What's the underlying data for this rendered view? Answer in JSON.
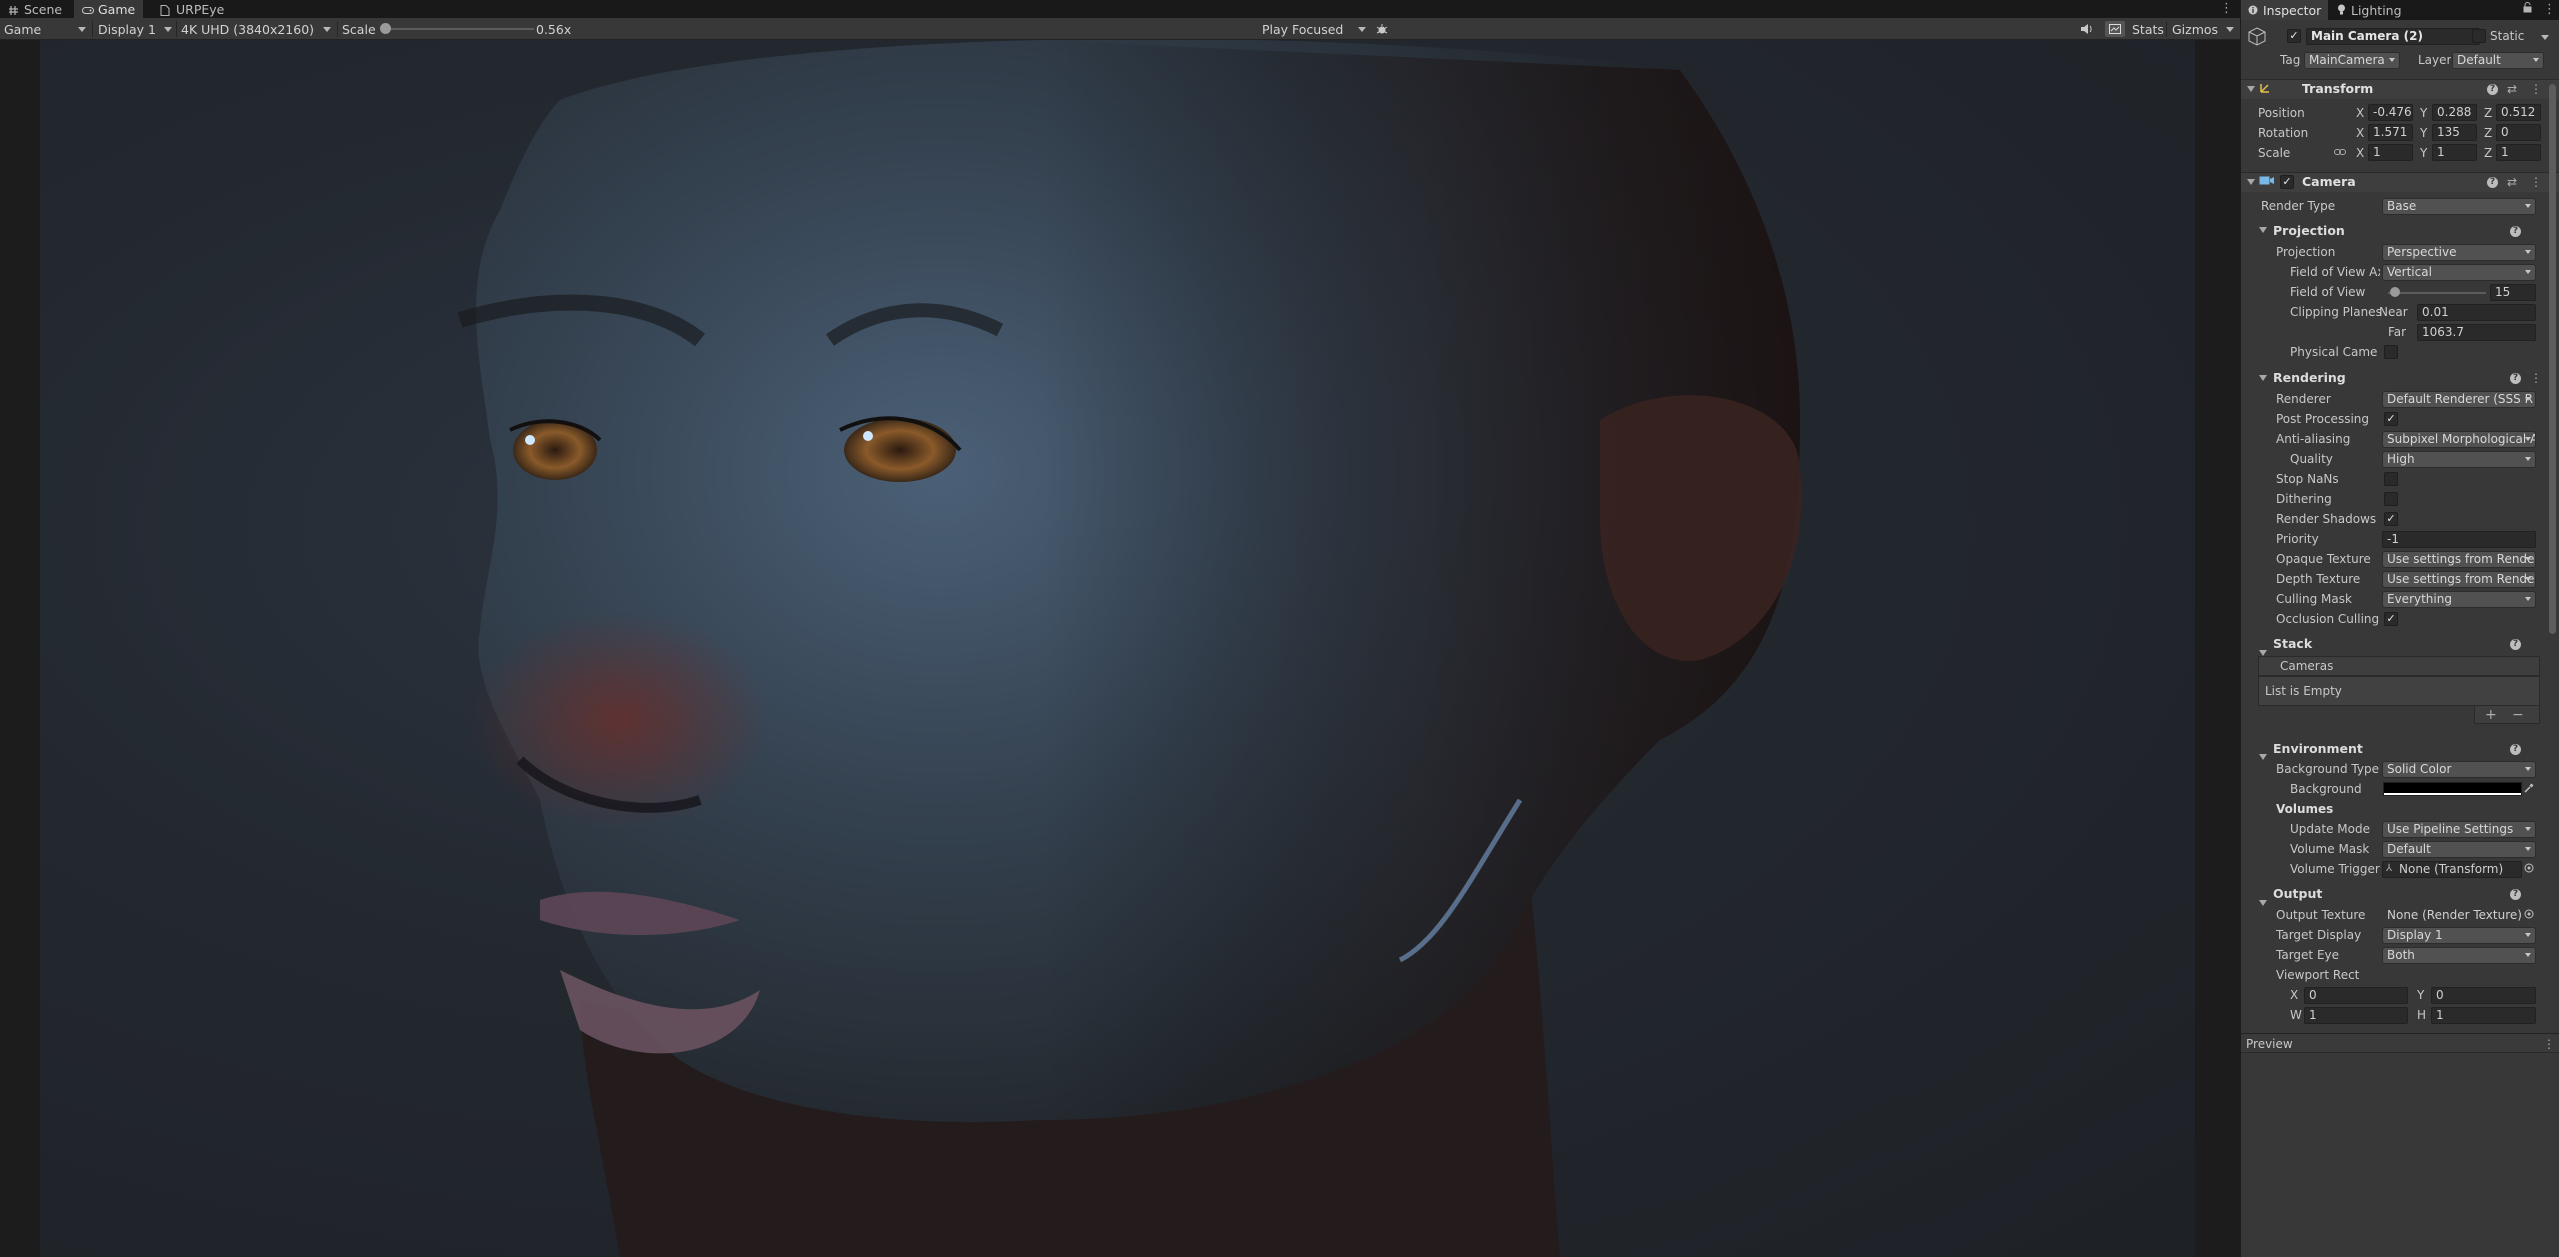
{
  "tabs": [
    {
      "label": "Scene",
      "icon": "hash-icon",
      "active": false
    },
    {
      "label": "Game",
      "icon": "gamepad-icon",
      "active": true
    },
    {
      "label": "URPEye",
      "icon": "document-icon",
      "active": false
    }
  ],
  "game_toolbar": {
    "view_mode": "Game",
    "display": "Display 1",
    "resolution": "4K UHD (3840x2160)",
    "scale_label": "Scale",
    "scale_value": "0.56x",
    "play_mode": "Play Focused",
    "stats": "Stats",
    "gizmos": "Gizmos"
  },
  "inspector": {
    "tabs": [
      {
        "label": "Inspector",
        "icon": "info-icon"
      },
      {
        "label": "Lighting",
        "icon": "bulb-icon"
      }
    ],
    "object": {
      "name": "Main Camera (2)",
      "static_label": "Static",
      "tag_label": "Tag",
      "tag": "MainCamera",
      "layer_label": "Layer",
      "layer": "Default"
    },
    "transform": {
      "title": "Transform",
      "position_label": "Position",
      "rotation_label": "Rotation",
      "scale_label": "Scale",
      "position": {
        "x": "-0.476",
        "y": "0.288",
        "z": "0.512"
      },
      "rotation": {
        "x": "1.571",
        "y": "135",
        "z": "0"
      },
      "scale": {
        "x": "1",
        "y": "1",
        "z": "1"
      }
    },
    "camera": {
      "title": "Camera",
      "render_type_label": "Render Type",
      "render_type": "Base",
      "projection": {
        "title": "Projection",
        "projection_label": "Projection",
        "projection": "Perspective",
        "fov_axis_label": "Field of View Ax",
        "fov_axis": "Vertical",
        "fov_label": "Field of View",
        "fov": "15",
        "clip_label": "Clipping Planes",
        "near_label": "Near",
        "near": "0.01",
        "far_label": "Far",
        "far": "1063.7",
        "physical_label": "Physical Camer"
      },
      "rendering": {
        "title": "Rendering",
        "renderer_label": "Renderer",
        "renderer": "Default Renderer (SSS R",
        "post_label": "Post Processing",
        "aa_label": "Anti-aliasing",
        "aa": "Subpixel Morphological A",
        "quality_label": "Quality",
        "quality": "High",
        "nans_label": "Stop NaNs",
        "dither_label": "Dithering",
        "shadows_label": "Render Shadows",
        "priority_label": "Priority",
        "priority": "-1",
        "opaque_label": "Opaque Texture",
        "opaque": "Use settings from Rende",
        "depth_label": "Depth Texture",
        "depth": "Use settings from Rende",
        "culling_label": "Culling Mask",
        "culling": "Everything",
        "occlusion_label": "Occlusion Culling"
      },
      "stack": {
        "title": "Stack",
        "cameras_label": "Cameras",
        "empty": "List is Empty"
      },
      "environment": {
        "title": "Environment",
        "bg_type_label": "Background Type",
        "bg_type": "Solid Color",
        "bg_label": "Background",
        "volumes_label": "Volumes",
        "update_label": "Update Mode",
        "update": "Use Pipeline Settings",
        "mask_label": "Volume Mask",
        "mask": "Default",
        "trigger_label": "Volume Trigger",
        "trigger": "None (Transform)"
      },
      "output": {
        "title": "Output",
        "texture_label": "Output Texture",
        "texture": "None (Render Texture)",
        "display_label": "Target Display",
        "display": "Display 1",
        "eye_label": "Target Eye",
        "eye": "Both",
        "viewport_label": "Viewport Rect",
        "x": "0",
        "y": "0",
        "w": "1",
        "h": "1"
      }
    },
    "preview_label": "Preview"
  },
  "colors": {
    "panel": "#383838",
    "field": "#2a2a2a",
    "accent": "#4aa3ff"
  }
}
